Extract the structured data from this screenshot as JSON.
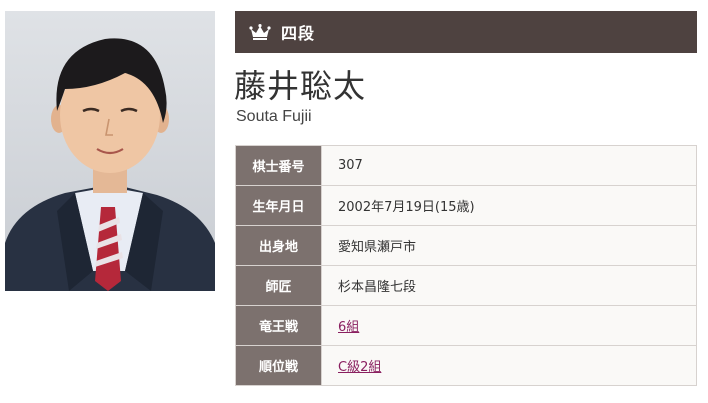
{
  "header": {
    "rank_icon": "crown-icon",
    "rank": "四段",
    "name_jp": "藤井聡太",
    "name_en": "Souta Fujii"
  },
  "profile": {
    "rows": [
      {
        "label": "棋士番号",
        "value": "307",
        "link": false
      },
      {
        "label": "生年月日",
        "value": "2002年7月19日(15歳)",
        "link": false
      },
      {
        "label": "出身地",
        "value": "愛知県瀬戸市",
        "link": false
      },
      {
        "label": "師匠",
        "value": "杉本昌隆七段",
        "link": false
      },
      {
        "label": "竜王戦",
        "value": "6組",
        "link": true
      },
      {
        "label": "順位戦",
        "value": "C級2組",
        "link": true
      }
    ]
  },
  "colors": {
    "header_bar": "#4e4240",
    "label_cell": "#7c716e",
    "link": "#8a2060"
  }
}
